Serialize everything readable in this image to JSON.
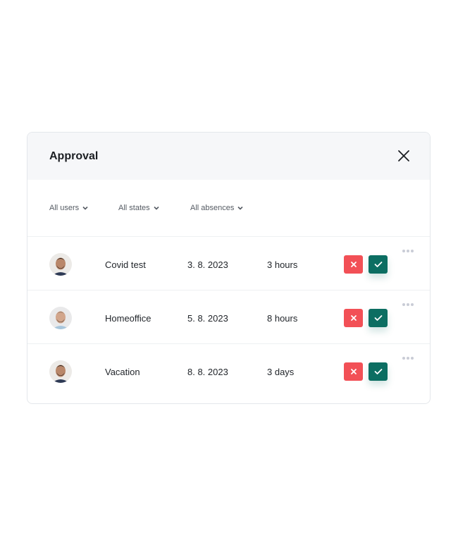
{
  "dialog": {
    "title": "Approval",
    "close_icon": "close-icon"
  },
  "filters": [
    {
      "label": "All users",
      "icon": "chevron-down-icon"
    },
    {
      "label": "All states",
      "icon": "chevron-down-icon"
    },
    {
      "label": "All absences",
      "icon": "chevron-down-icon"
    }
  ],
  "requests": [
    {
      "avatar": "user-avatar-1",
      "type": "Covid test",
      "date": "3. 8. 2023",
      "duration": "3 hours"
    },
    {
      "avatar": "user-avatar-2",
      "type": "Homeoffice",
      "date": "5. 8. 2023",
      "duration": "8 hours"
    },
    {
      "avatar": "user-avatar-1",
      "type": "Vacation",
      "date": "8. 8. 2023",
      "duration": "3 days"
    }
  ],
  "colors": {
    "reject": "#f25056",
    "approve": "#0c6e62",
    "header_bg": "#f6f7f9"
  }
}
